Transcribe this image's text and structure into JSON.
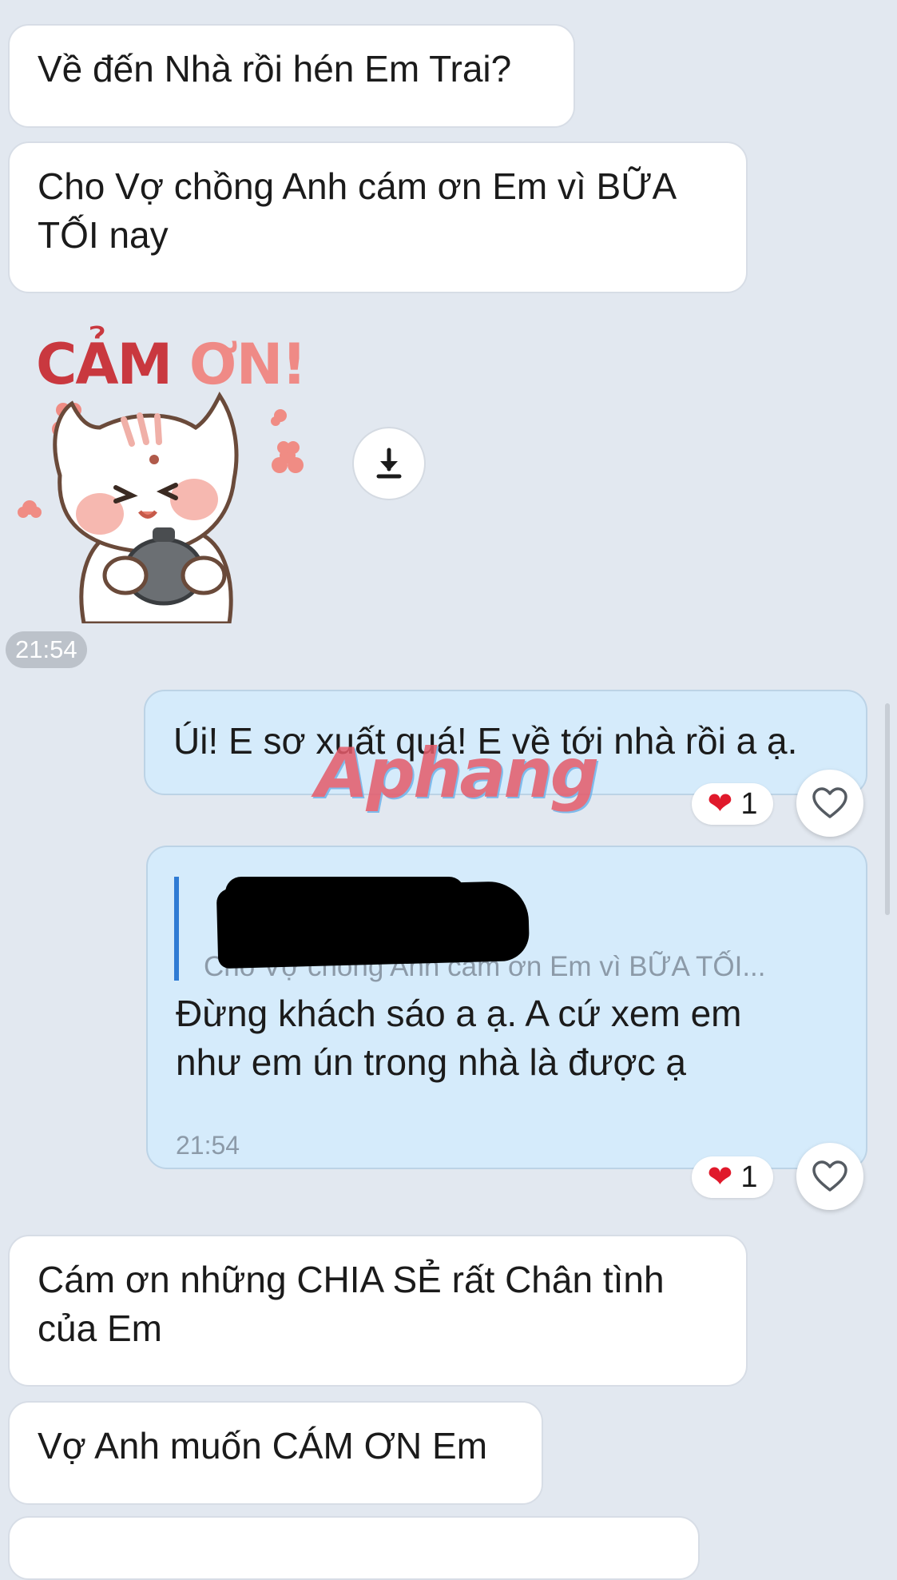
{
  "messages": {
    "m1": "Về đến Nhà rồi hén Em Trai?",
    "m2": "Cho Vợ chồng Anh cám ơn Em vì BỮA\nTỐI nay",
    "m3": "Úi! E sơ xuất quá! E về tới nhà rồi a ạ.",
    "m4": "Cám ơn những CHIA SẺ rất Chân tình\ncủa Em",
    "m5": "Vợ Anh muốn CÁM ƠN Em"
  },
  "sticker": {
    "text_part1": "CẢM",
    "text_part2": "ƠN!"
  },
  "timestamp_badge": "21:54",
  "reply": {
    "quoted_text": "Cho Vợ chồng Anh cám ơn Em vì BỮA TỐI...",
    "text": "Đừng khách sáo a ạ. A cứ xem em\nnhư em ún trong nhà là được ạ",
    "time": "21:54"
  },
  "reactions": [
    {
      "emoji": "❤",
      "count": "1"
    },
    {
      "emoji": "❤",
      "count": "1"
    }
  ],
  "watermark": "Aphang",
  "colors": {
    "background": "#e2e8f0",
    "received_bubble": "#ffffff",
    "sent_bubble": "#d5ebfb",
    "quote_bar": "#2f7bd4",
    "reaction_heart": "#e0192b"
  },
  "icons": {
    "download": "download-icon",
    "like": "heart-outline-icon"
  }
}
